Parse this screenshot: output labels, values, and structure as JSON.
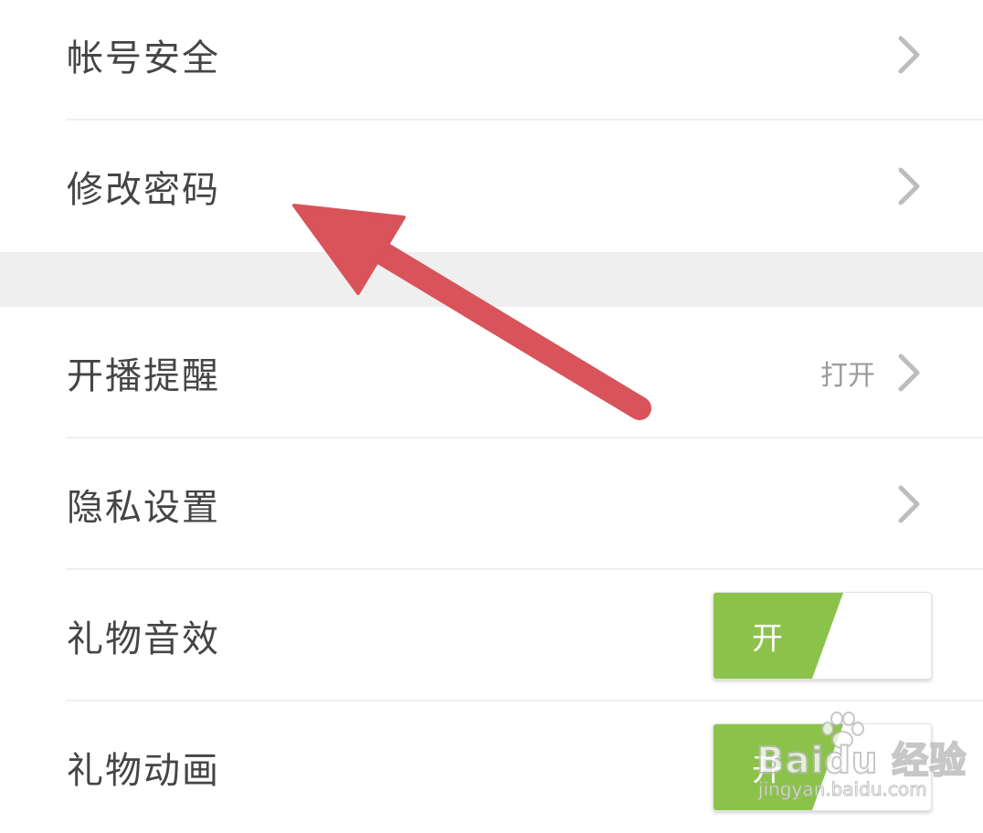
{
  "settings": {
    "items": [
      {
        "label": "帐号安全"
      },
      {
        "label": "修改密码"
      },
      {
        "label": "开播提醒",
        "value": "打开"
      },
      {
        "label": "隐私设置"
      },
      {
        "label": "礼物音效",
        "toggle": "开",
        "on": true
      },
      {
        "label": "礼物动画",
        "toggle": "开",
        "on": true
      }
    ]
  },
  "watermark": {
    "brand": "Baidu 经验",
    "url": "jingyan.baidu.com"
  },
  "colors": {
    "toggle_on": "#8bc34a",
    "arrow": "#d9535a",
    "text": "#454545",
    "secondary": "#9b9b9b",
    "section_gap": "#efefef"
  },
  "icons": {
    "chevron": "chevron-right-icon",
    "annotation": "red-arrow-annotation",
    "watermark_logo": "baidu-paw-icon"
  }
}
